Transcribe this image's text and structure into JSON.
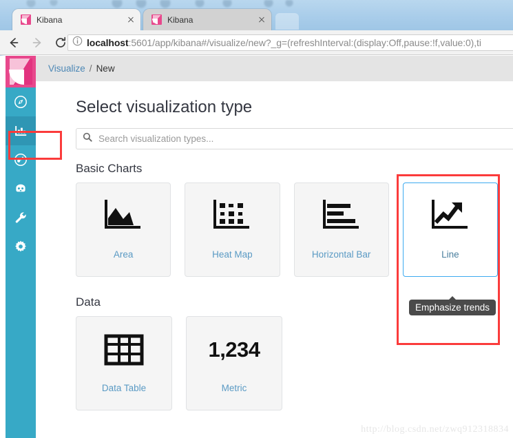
{
  "browser": {
    "tabs": [
      {
        "title": "Kibana",
        "active": true,
        "favicon": "kibana-favicon",
        "close": "close-icon"
      },
      {
        "title": "Kibana",
        "active": false,
        "favicon": "kibana-favicon",
        "close": "close-icon"
      }
    ],
    "new_tab_label": "",
    "nav": {
      "back": "back-arrow-icon",
      "forward": "forward-arrow-icon",
      "reload": "reload-icon"
    },
    "omnibox": {
      "info_icon": "page-info-icon",
      "url_host": "localhost",
      "url_rest": ":5601/app/kibana#/visualize/new?_g=(refreshInterval:(display:Off,pause:!f,value:0),ti"
    }
  },
  "sidebar": {
    "logo": "kibana-logo",
    "items": [
      {
        "name": "discover",
        "icon": "compass-icon",
        "active": false
      },
      {
        "name": "visualize",
        "icon": "bar-chart-icon",
        "active": true
      },
      {
        "name": "dashboard",
        "icon": "dashboard-gauge-icon",
        "active": false
      },
      {
        "name": "timelion",
        "icon": "timelion-icon",
        "active": false
      },
      {
        "name": "dev-tools",
        "icon": "wrench-icon",
        "active": false
      },
      {
        "name": "management",
        "icon": "gear-icon",
        "active": false
      }
    ]
  },
  "breadcrumb": {
    "root": "Visualize",
    "separator": "/",
    "current": "New"
  },
  "main": {
    "title": "Select visualization type",
    "search": {
      "icon": "search-icon",
      "value": "",
      "placeholder": "Search visualization types..."
    },
    "sections": [
      {
        "heading": "Basic Charts",
        "cards": [
          {
            "label": "Area",
            "icon": "area-chart-icon",
            "hovered": false
          },
          {
            "label": "Heat Map",
            "icon": "heat-map-icon",
            "hovered": false
          },
          {
            "label": "Horizontal Bar",
            "icon": "horizontal-bar-icon",
            "hovered": false
          },
          {
            "label": "Line",
            "icon": "line-chart-icon",
            "hovered": true,
            "tooltip": "Emphasize trends"
          }
        ]
      },
      {
        "heading": "Data",
        "cards": [
          {
            "label": "Data Table",
            "icon": "data-table-icon",
            "hovered": false
          },
          {
            "label": "Metric",
            "icon": "metric-number",
            "value": "1,234",
            "hovered": false
          }
        ]
      }
    ]
  },
  "annotations": {
    "sidebar_highlight": "red-rectangle",
    "line_card_highlight": "red-rectangle",
    "color": "#fb3b3b"
  },
  "watermark": "http://blog.csdn.net/zwq912318834",
  "colors": {
    "kibana_pink": "#e8488c",
    "sidebar_teal": "#37a9c6",
    "sidebar_active": "#2f96b4",
    "link_blue": "#5a9ac4",
    "hover_border": "#3caaf0",
    "annotation_red": "#fb3b3b"
  }
}
